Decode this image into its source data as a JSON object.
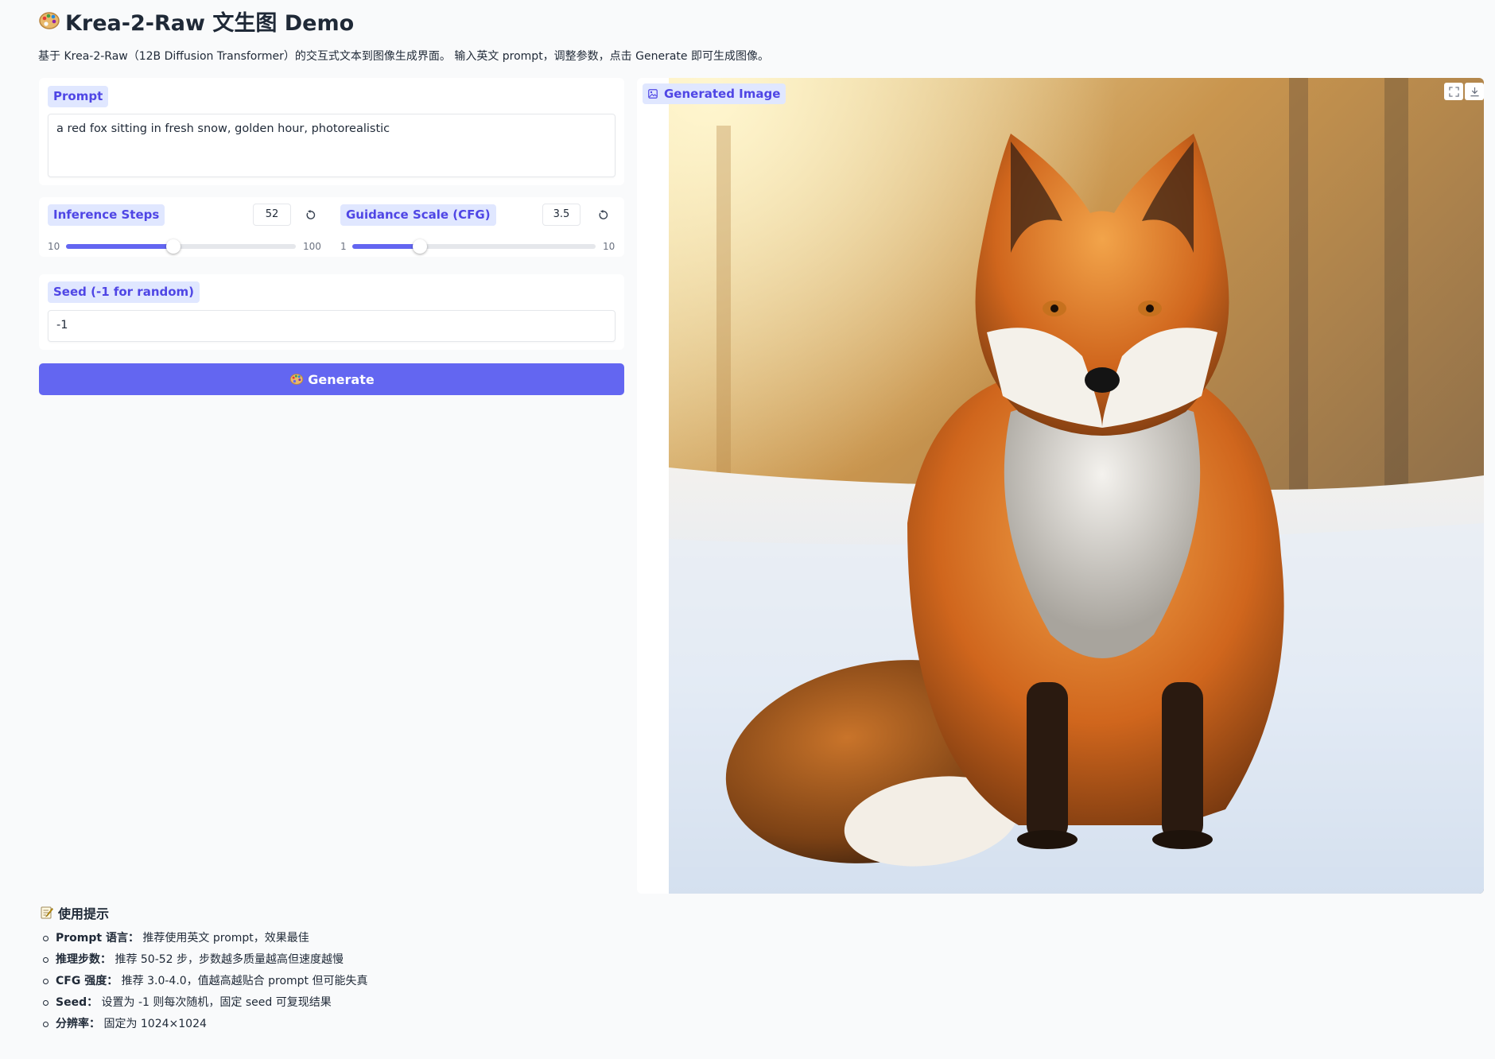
{
  "header": {
    "title": "Krea-2-Raw 文生图 Demo",
    "subtitle": "基于 Krea-2-Raw（12B Diffusion Transformer）的交互式文本到图像生成界面。 输入英文 prompt，调整参数，点击 Generate 即可生成图像。"
  },
  "prompt": {
    "label": "Prompt",
    "value": "a red fox sitting in fresh snow, golden hour, photorealistic"
  },
  "steps": {
    "label": "Inference Steps",
    "value": "52",
    "min": "10",
    "max": "100",
    "level": 0.4667
  },
  "cfg": {
    "label": "Guidance Scale (CFG)",
    "value": "3.5",
    "min": "1",
    "max": "10",
    "level": 0.2778
  },
  "seed": {
    "label": "Seed (-1 for random)",
    "value": "-1"
  },
  "generate_button": {
    "label": "Generate"
  },
  "output": {
    "label": "Generated Image"
  },
  "tips": {
    "title": "使用提示",
    "items": [
      {
        "key": "Prompt 语言：",
        "text": " 推荐使用英文 prompt，效果最佳"
      },
      {
        "key": "推理步数：",
        "text": " 推荐 50-52 步，步数越多质量越高但速度越慢"
      },
      {
        "key": "CFG 强度：",
        "text": " 推荐 3.0-4.0，值越高越贴合 prompt 但可能失真"
      },
      {
        "key": "Seed：",
        "text": " 设置为 -1 则每次随机，固定 seed 可复现结果"
      },
      {
        "key": "分辨率：",
        "text": " 固定为 1024×1024"
      }
    ]
  },
  "colors": {
    "accent": "#6366f1",
    "chip_bg": "#e0e7ff",
    "chip_text": "#4f46e5",
    "page_bg": "#f9fafb"
  }
}
